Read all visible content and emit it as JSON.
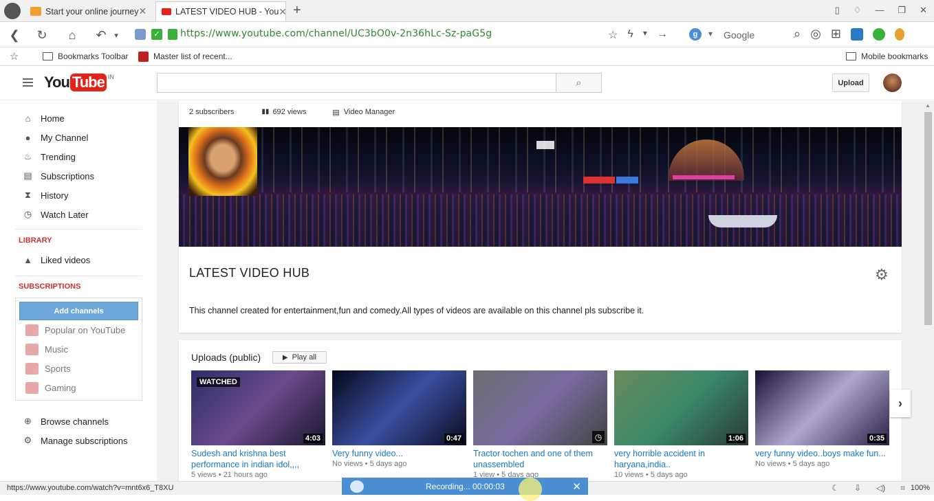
{
  "browser": {
    "tabs": [
      {
        "title": "Start your online journey",
        "active": false,
        "favicon_color": "#f0a030"
      },
      {
        "title": "LATEST VIDEO HUB - You",
        "active": true,
        "favicon_color": "#e62117"
      }
    ],
    "url": "https://www.youtube.com/channel/UC3bO0v-2n36hLc-Sz-paG5g",
    "search_engine": "Google",
    "bookmarks": {
      "toolbar_label": "Bookmarks Toolbar",
      "item": "Master list of recent...",
      "mobile": "Mobile bookmarks"
    },
    "status_url": "https://www.youtube.com/watch?v=mnt6x6_T8XU",
    "zoom": "100%"
  },
  "youtube": {
    "logo_text": "YouTube",
    "logo_region": "IN",
    "upload_label": "Upload",
    "search_placeholder": ""
  },
  "sidebar": {
    "nav": [
      {
        "label": "Home",
        "icon": "home-icon"
      },
      {
        "label": "My Channel",
        "icon": "user-circle-icon"
      },
      {
        "label": "Trending",
        "icon": "flame-icon"
      },
      {
        "label": "Subscriptions",
        "icon": "subscriptions-icon"
      },
      {
        "label": "History",
        "icon": "hourglass-icon"
      },
      {
        "label": "Watch Later",
        "icon": "clock-icon"
      }
    ],
    "library_heading": "LIBRARY",
    "library": [
      {
        "label": "Liked videos",
        "icon": "thumbs-up-icon"
      }
    ],
    "subscriptions_heading": "SUBSCRIPTIONS",
    "add_channels": "Add channels",
    "subscriptions": [
      {
        "label": "Popular on YouTube"
      },
      {
        "label": "Music"
      },
      {
        "label": "Sports"
      },
      {
        "label": "Gaming"
      }
    ],
    "browse_channels": "Browse channels",
    "manage_subscriptions": "Manage subscriptions"
  },
  "channel": {
    "subscribers": "2 subscribers",
    "views": "692 views",
    "video_manager": "Video Manager",
    "title": "LATEST VIDEO HUB",
    "description": "This channel created for entertainment,fun and comedy.All types of videos are available on this channel pls subscribe it."
  },
  "uploads": {
    "heading": "Uploads (public)",
    "play_all": "Play all",
    "videos": [
      {
        "title": "Sudesh and krishna best performance in indian idol,,,,",
        "duration": "4:03",
        "views": "5 views",
        "age": "21 hours ago",
        "badge": "WATCHED",
        "colors": [
          "#2a2f6a",
          "#6a4a8a",
          "#1a1530"
        ]
      },
      {
        "title": "Very funny video...",
        "duration": "0:47",
        "views": "No views",
        "age": "5 days ago",
        "badge": "",
        "colors": [
          "#05081a",
          "#3a4fa0",
          "#0a0c20"
        ]
      },
      {
        "title": "Tractor tochen and one of them unassembled",
        "duration": "",
        "views": "1 view",
        "age": "5 days ago",
        "badge": "",
        "colors": [
          "#6a6f70",
          "#7a6aa0",
          "#3f4540"
        ]
      },
      {
        "title": "very horrible accident in haryana,india..",
        "duration": "1:06",
        "views": "10 views",
        "age": "5 days ago",
        "badge": "",
        "colors": [
          "#6a8a5a",
          "#3a8a6a",
          "#2a3a30"
        ]
      },
      {
        "title": "very funny video..boys make fun...",
        "duration": "0:35",
        "views": "No views",
        "age": "5 days ago",
        "badge": "",
        "colors": [
          "#1a1030",
          "#b0a8d0",
          "#2a1f45"
        ]
      }
    ]
  },
  "recorder": {
    "text": "Recording... 00:00:03"
  }
}
